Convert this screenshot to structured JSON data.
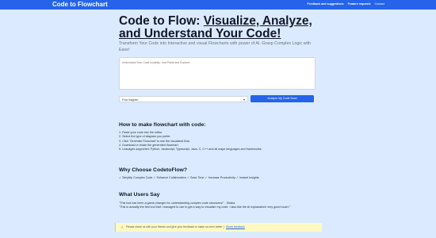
{
  "nav": {
    "brand": "Code to Flowchart",
    "links": [
      "Feedback and suggestions",
      "Feature requests",
      "Contact"
    ]
  },
  "hero": {
    "title_plain": "Code to Flow: ",
    "title_link": "Visualize, Analyze, and Understand Your Code!",
    "subtitle": "Transform Your Code into Interactive and visual Flowcharts with power of AI. Grasp Complex Logic with Ease!"
  },
  "editor": {
    "placeholder": "Understand Your Code Instantly: Just Paste and Explore!"
  },
  "diagram_select": {
    "value": "Flow diagram"
  },
  "analyze_button": "Analyze My Code Now!",
  "how_to": {
    "heading": "How to make flowchart with code:",
    "steps": [
      "1. Paste your code into the editor.",
      "2. Select the type of diagram you prefer.",
      "3. Click 'Generate Flowchart' to see the visualized flow.",
      "4. Download or share the generated flowchart.",
      "5. Lnauages supported: Python, Javascript, Typescript, Java, C, C++ and all major languages and frameworks"
    ]
  },
  "why": {
    "heading": "Why Choose CodetoFlow?",
    "benefits": "✓ Simplify Complex Code ✓ Enhance Collaboration ✓ Save Time ✓ Increase Productivity ✓ Instant Insights"
  },
  "testimonials": {
    "heading": "What Users Say",
    "quotes": [
      "\"This tool has been a game-changer for understanding complex code structures!\" - Shaba",
      "\"This is actually the first tool that I managed to use to get a way to visualize my code. I also like the AI explanation! very good touch! \""
    ]
  },
  "feedback": {
    "text": "Please share us with your friends and give your feedback to make us even better. |",
    "link": "Share feedback",
    "icon": "warning-icon"
  }
}
